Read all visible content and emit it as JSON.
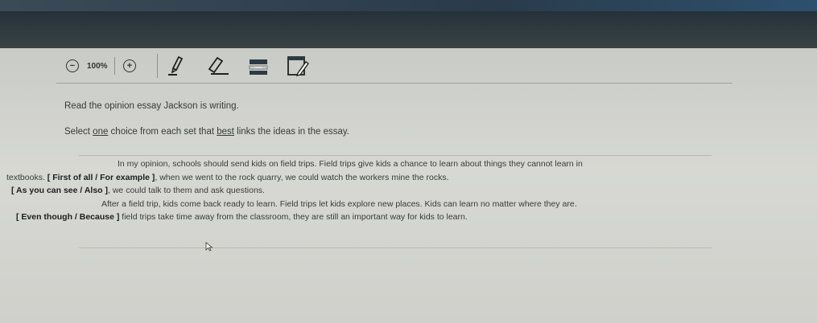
{
  "toolbar": {
    "zoom_level": "100%",
    "zoom_out_symbol": "−",
    "zoom_in_symbol": "+",
    "icons": [
      "zoom-out-icon",
      "zoom-in-icon",
      "highlighter-icon",
      "eraser-icon",
      "line-reader-icon",
      "notepad-icon"
    ]
  },
  "instructions": {
    "line1": "Read the opinion essay Jackson is writing.",
    "line2_pre": "Select ",
    "line2_u1": "one",
    "line2_mid": " choice from each set that ",
    "line2_u2": "best",
    "line2_post": " links the ideas in the essay."
  },
  "essay": {
    "p1_l1": "In my opinion, schools should send kids on field trips. Field trips give kids a chance to learn about things they cannot learn in",
    "p1_l2_pre": "textbooks. ",
    "set1": "[ First of all  /  For example ]",
    "p1_l2_post": ", when we went to the rock quarry, we could watch the workers mine the rocks.",
    "set2": "[ As you can see  /  Also ]",
    "p1_l3_post": ", we could talk to them and ask questions.",
    "p2_l1": "After a field trip, kids come back ready to learn. Field trips let kids explore new places. Kids can learn no matter where they are.",
    "set3": "[ Even though  /  Because ]",
    "p2_l2_post": " field trips take time away from the classroom, they are still an important way for kids to learn."
  },
  "colors": {
    "background": "#d7d8d3",
    "bezel": "#2e3a40",
    "text": "#3a3a3a"
  }
}
